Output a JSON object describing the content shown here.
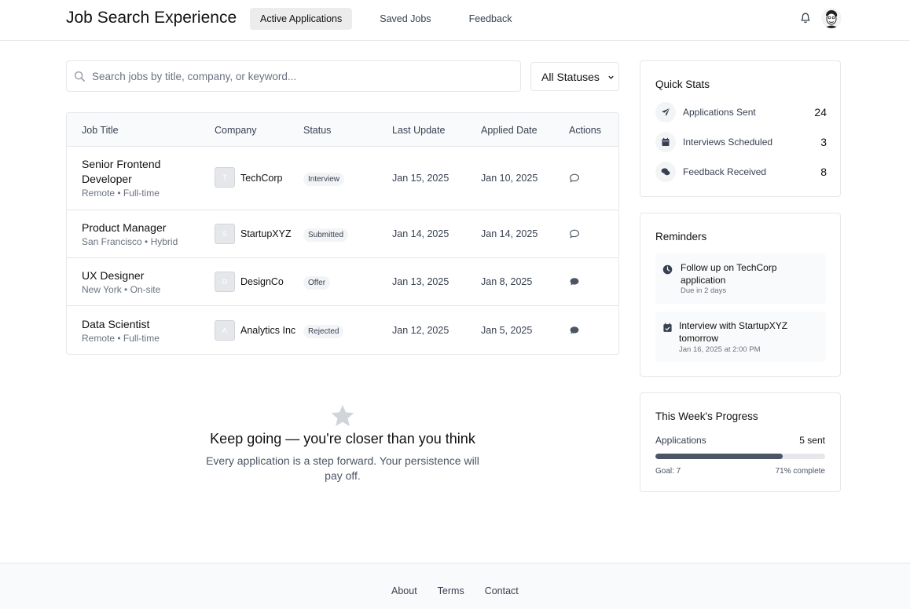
{
  "header": {
    "title": "Job Search Experience",
    "nav": [
      "Active Applications",
      "Saved Jobs",
      "Feedback"
    ]
  },
  "search": {
    "placeholder": "Search jobs by title, company, or keyword...",
    "value": ""
  },
  "filter": {
    "selected": "All Statuses"
  },
  "table": {
    "headers": [
      "Job Title",
      "Company",
      "Status",
      "Last Update",
      "Applied Date",
      "Actions"
    ],
    "rows": [
      {
        "title": "Senior Frontend Developer",
        "meta": "Remote • Full-time",
        "company_initial": "T",
        "company": "TechCorp",
        "status": "Interview",
        "last_update": "Jan 15, 2025",
        "applied": "Jan 10, 2025",
        "action_icon": "chat-outline-icon"
      },
      {
        "title": "Product Manager",
        "meta": "San Francisco • Hybrid",
        "company_initial": "S",
        "company": "StartupXYZ",
        "status": "Submitted",
        "last_update": "Jan 14, 2025",
        "applied": "Jan 14, 2025",
        "action_icon": "chat-outline-icon"
      },
      {
        "title": "UX Designer",
        "meta": "New York • On-site",
        "company_initial": "D",
        "company": "DesignCo",
        "status": "Offer",
        "last_update": "Jan 13, 2025",
        "applied": "Jan 8, 2025",
        "action_icon": "chat-filled-icon"
      },
      {
        "title": "Data Scientist",
        "meta": "Remote • Full-time",
        "company_initial": "A",
        "company": "Analytics Inc",
        "status": "Rejected",
        "last_update": "Jan 12, 2025",
        "applied": "Jan 5, 2025",
        "action_icon": "chat-filled-icon"
      }
    ]
  },
  "encouragement": {
    "heading": "Keep going — you're closer than you think",
    "body": "Every application is a step forward. Your persistence will pay off."
  },
  "quick_stats": {
    "title": "Quick Stats",
    "items": [
      {
        "label": "Applications Sent",
        "value": "24",
        "icon": "paper-plane-icon"
      },
      {
        "label": "Interviews Scheduled",
        "value": "3",
        "icon": "calendar-icon"
      },
      {
        "label": "Feedback Received",
        "value": "8",
        "icon": "comments-icon"
      }
    ]
  },
  "reminders": {
    "title": "Reminders",
    "items": [
      {
        "text": "Follow up on TechCorp application",
        "sub": "Due in 2 days",
        "icon": "clock-icon"
      },
      {
        "text": "Interview with StartupXYZ tomorrow",
        "sub": "Jan 16, 2025 at 2:00 PM",
        "icon": "calendar-check-icon"
      }
    ]
  },
  "progress": {
    "title": "This Week's Progress",
    "label": "Applications",
    "value": "5 sent",
    "fraction": 0.75,
    "goal": "Goal: 7",
    "percent": "71% complete"
  },
  "footer": {
    "links": [
      "About",
      "Terms",
      "Contact"
    ]
  },
  "colors": {
    "accent": "#4b5563",
    "border": "#e5e7eb",
    "badge_bg": "#f3f4f6"
  }
}
